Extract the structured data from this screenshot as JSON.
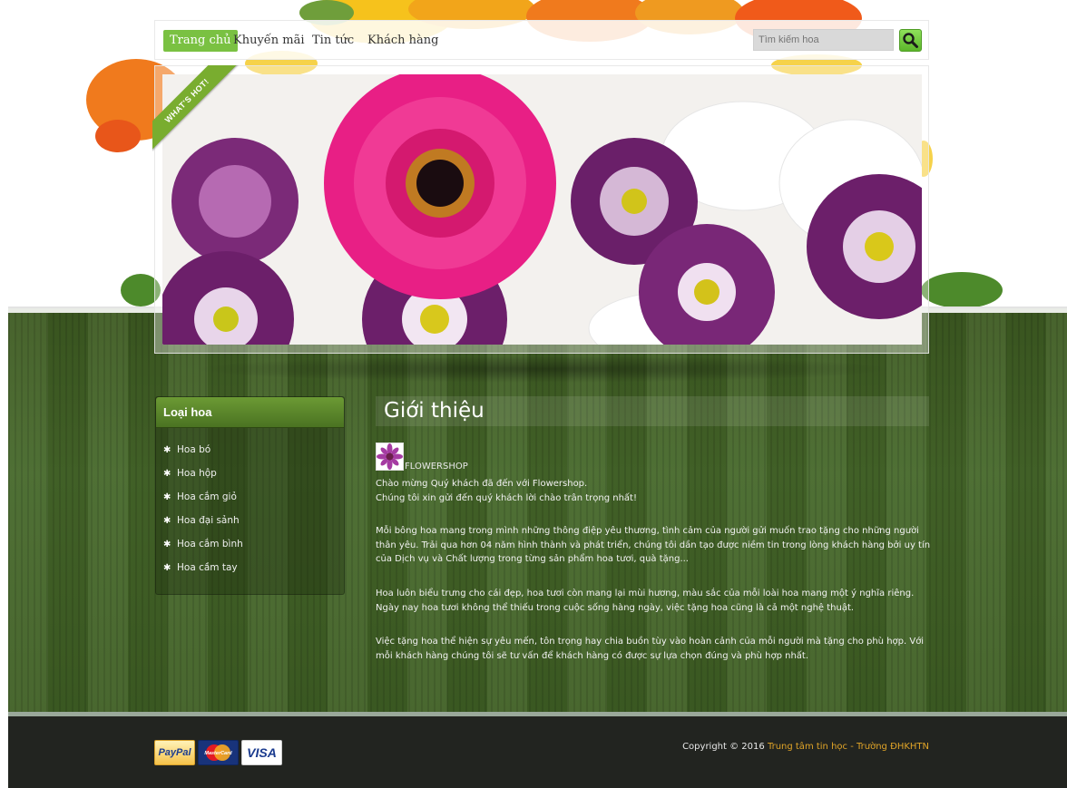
{
  "nav": {
    "items": [
      {
        "label": "Trang chủ",
        "active": true
      },
      {
        "label": "Khuyến mãi",
        "active": false
      },
      {
        "label": "Tin tức",
        "active": false
      },
      {
        "label": "Khách hàng",
        "active": false
      }
    ],
    "search_placeholder": "Tìm kiếm hoa",
    "search_icon": "search-icon"
  },
  "slider": {
    "ribbon_text": "WHAT'S HOT!"
  },
  "sidebar": {
    "title": "Loại hoa",
    "items": [
      "Hoa bó",
      "Hoa hộp",
      "Hoa cắm giỏ",
      "Hoa đại sảnh",
      "Hoa cắm bình",
      "Hoa cầm tay"
    ]
  },
  "content": {
    "title": "Giới thiệu",
    "brand": "FLOWERSHOP",
    "paragraphs": [
      "Chào mừng Quý khách đã đến với Flowershop.\nChúng tôi xin gửi đến quý khách lời chào trân trọng nhất!",
      "Mỗi bông hoa mang trong mình những thông điệp yêu thương, tình cảm của người gửi muốn trao tặng cho những người thân yêu. Trải qua hơn 04 năm hình thành và phát triển, chúng tôi dần tạo được niềm tin trong lòng khách hàng bởi uy tín của Dịch vụ và Chất lượng trong từng sản phẩm hoa tươi, quà tặng...",
      "Hoa luôn biểu trưng cho cái đẹp, hoa tươi còn mang lại mùi hương, màu sắc của mỗi loài hoa mang một ý nghĩa riêng. Ngày nay hoa tươi không thể thiếu trong cuộc sống hàng ngày, việc tặng hoa cũng là cả một nghệ thuật.",
      "Việc tặng hoa thể hiện sự yêu mến, tôn trọng hay chia buồn tùy vào hoàn cảnh của mỗi người mà tặng cho phù hợp. Với mỗi khách hàng chúng tôi sẽ tư vấn để khách hàng có được sự lựa chọn đúng và phù hợp nhất."
    ]
  },
  "footer": {
    "payments": [
      "PayPal",
      "MasterCard",
      "VISA"
    ],
    "copyright_prefix": "Copyright © 2016",
    "copyright_link": "Trung tâm tin học - Trường ĐHKHTN"
  },
  "colors": {
    "accent_green": "#7ac142",
    "band_green": "#3f5e22",
    "footer_bg": "#222420",
    "link_orange": "#e0a428"
  }
}
